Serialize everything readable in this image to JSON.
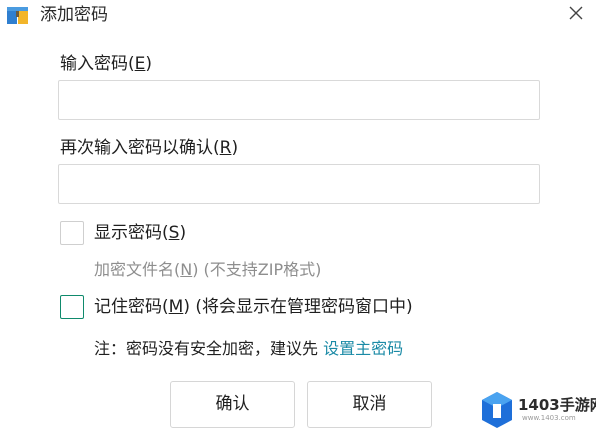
{
  "dialog": {
    "title": "添加密码",
    "close_icon": "close-icon",
    "app_icon": "archive-icon"
  },
  "password": {
    "label": "输入密码(",
    "accesskey": "E",
    "label_end": ")",
    "value": ""
  },
  "confirm": {
    "label": "再次输入密码以确认(",
    "accesskey": "R",
    "label_end": ")",
    "value": ""
  },
  "show_password": {
    "label": "显示密码(",
    "accesskey": "S",
    "label_end": ")",
    "checked": false
  },
  "encrypt_filename": {
    "label": "加密文件名(",
    "accesskey": "N",
    "label_end": ") (不支持ZIP格式)",
    "enabled": false
  },
  "remember_password": {
    "label": "记住密码(",
    "accesskey": "M",
    "label_end": ") (将会显示在管理密码窗口中)",
    "checked": false
  },
  "note": {
    "text": "注：密码没有安全加密，建议先 ",
    "link": "设置主密码"
  },
  "buttons": {
    "ok": "确认",
    "cancel": "取消"
  },
  "watermark": {
    "text": "1403手游网",
    "sub": "www.1403.com"
  },
  "colors": {
    "accent": "#0f8a6c",
    "link": "#1a8aa6",
    "disabled": "#8e8e8e"
  }
}
